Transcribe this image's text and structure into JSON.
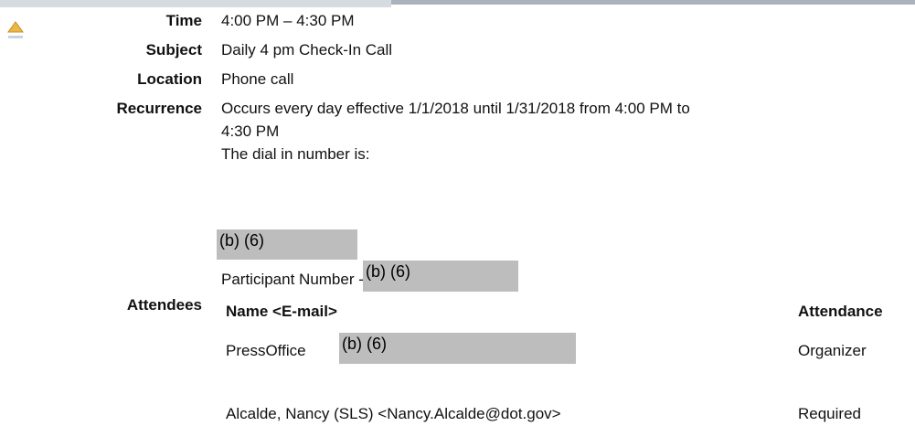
{
  "fields": {
    "time_label": "Time",
    "time_value": "4:00 PM – 4:30 PM",
    "subject_label": "Subject",
    "subject_value": "Daily 4 pm Check-In Call",
    "location_label": "Location",
    "location_value": "Phone call",
    "recurrence_label": "Recurrence",
    "recurrence_line1": "Occurs every day effective 1/1/2018 until 1/31/2018 from 4:00 PM to",
    "recurrence_line2": "4:30 PM",
    "dial_in_text": "The dial in number is:",
    "redaction_code_1": "(b) (6)",
    "participant_number_label": "Participant Number -",
    "redaction_code_2": "(b) (6)",
    "attendees_label": "Attendees"
  },
  "attendees_table": {
    "col_name": "Name <E-mail>",
    "col_attendance": "Attendance",
    "rows": [
      {
        "name": "PressOffice",
        "redaction": "(b) (6)",
        "attendance": "Organizer"
      },
      {
        "name": "Alcalde, Nancy (SLS) <Nancy.Alcalde@dot.gov>",
        "attendance": "Required"
      }
    ]
  },
  "icons": {
    "collapse_toggle": "triangle-up-icon"
  }
}
